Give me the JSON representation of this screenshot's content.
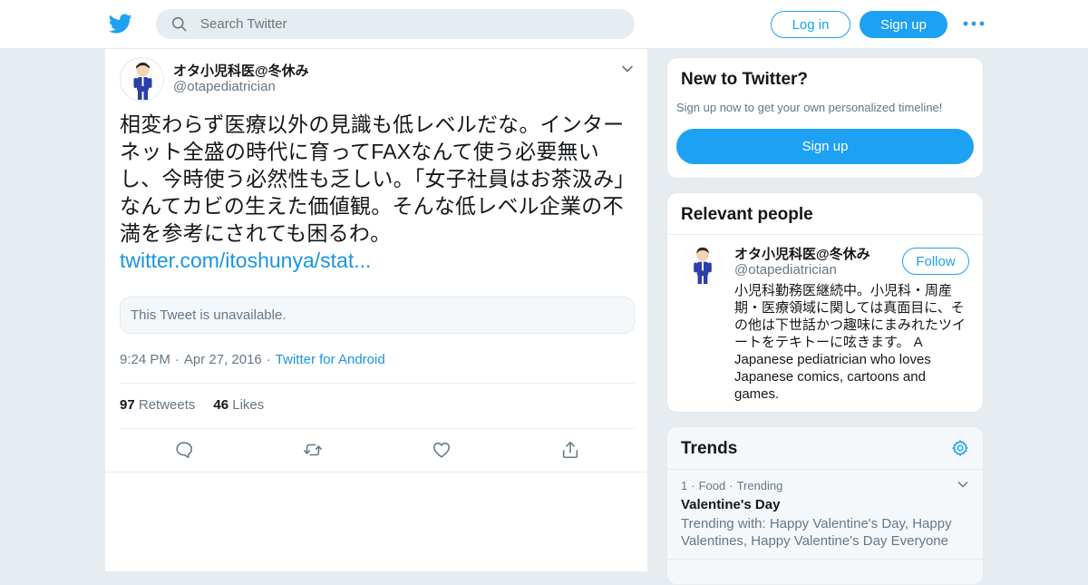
{
  "nav": {
    "search_placeholder": "Search Twitter",
    "login_label": "Log in",
    "signup_label": "Sign up",
    "logo_icon": "twitter-bird-icon",
    "more_icon": "more-dots-icon"
  },
  "tweet": {
    "author_name": "オタ小児科医@冬休み",
    "author_handle": "@otapediatrician",
    "text": "相変わらず医療以外の見識も低レベルだな。インターネット全盛の時代に育ってFAXなんて使う必要無いし、今時使う必然性も乏しい。「女子社員はお茶汲み」なんてカビの生えた価値観。そんな低レベル企業の不満を参考にされても困るわ。",
    "link": "twitter.com/itoshunya/stat...",
    "quoted_unavailable": "This Tweet is unavailable.",
    "time": "9:24 PM",
    "date": "Apr 27, 2016",
    "source": "Twitter for Android",
    "retweets_count": "97",
    "retweets_label": "Retweets",
    "likes_count": "46",
    "likes_label": "Likes"
  },
  "new_to_twitter": {
    "title": "New to Twitter?",
    "subtitle": "Sign up now to get your own personalized timeline!",
    "signup_label": "Sign up"
  },
  "relevant_people": {
    "title": "Relevant people",
    "name": "オタ小児科医@冬休み",
    "handle": "@otapediatrician",
    "follow_label": "Follow",
    "bio": "小児科勤務医継続中。小児科・周産期・医療領域に関しては真面目に、その他は下世話かつ趣味にまみれたツイートをテキトーに呟きます。 A Japanese pediatrician who loves Japanese comics, cartoons and games."
  },
  "trends": {
    "title": "Trends",
    "items": [
      {
        "rank": "1",
        "category": "Food",
        "status": "Trending",
        "name": "Valentine's Day",
        "description": "Trending with: Happy Valentine's Day, Happy Valentines, Happy Valentine's Day Everyone"
      }
    ]
  },
  "colors": {
    "brand": "#1da1f2",
    "link": "#1b95e0",
    "secondary_text": "#657786",
    "background": "#e6ecf0"
  }
}
